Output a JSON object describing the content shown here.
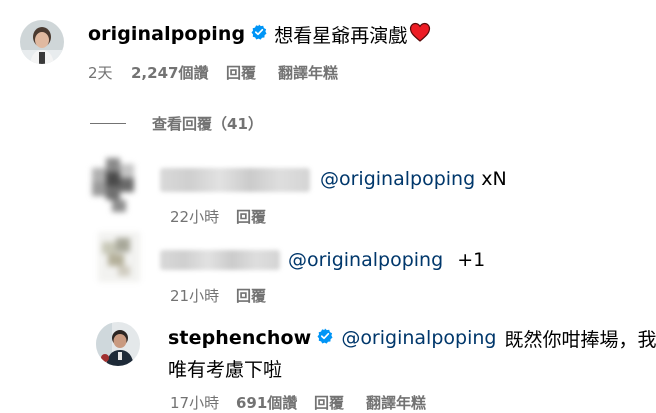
{
  "top_comment": {
    "username": "originalpoping",
    "text": "想看星爺再演戲",
    "emoji": "heart-emoji",
    "meta": {
      "time": "2天",
      "likes": "2,247個讚",
      "reply": "回覆",
      "translate": "翻譯年糕"
    },
    "view_replies": "查看回覆（41）"
  },
  "replies": [
    {
      "username_hidden": true,
      "mention": "@originalpoping",
      "text": "xN",
      "meta": {
        "time": "22小時",
        "reply": "回覆"
      }
    },
    {
      "username_hidden": true,
      "mention": "@originalpoping",
      "text": "+1",
      "meta": {
        "time": "21小時",
        "reply": "回覆"
      }
    },
    {
      "username": "stephenchow",
      "mention": "@originalpoping",
      "text_line1": "既然你咁捧場，我",
      "text_line2": "唯有考慮下啦",
      "meta": {
        "time": "17小時",
        "likes": "691個讚",
        "reply": "回覆",
        "translate": "翻譯年糕"
      }
    }
  ],
  "colors": {
    "verified": "#0095f6",
    "meta": "#737373",
    "mention": "#00376b",
    "heart": "#ed1c24"
  }
}
